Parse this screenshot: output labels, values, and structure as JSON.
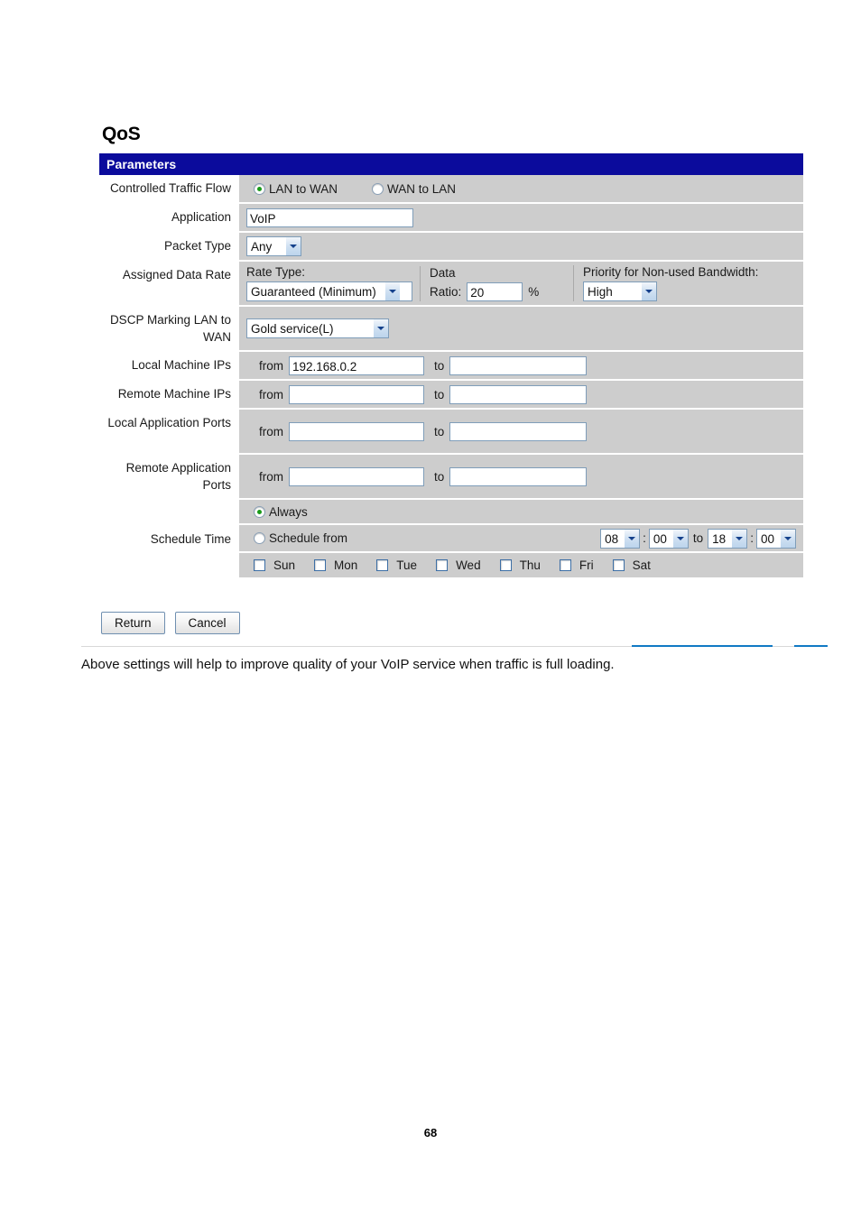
{
  "page": {
    "title": "QoS",
    "number": "68",
    "caption": "Above settings will help to improve quality of your VoIP service when traffic is full loading.",
    "accent_color": "#0b0b9c",
    "rule_color": "#1179c4"
  },
  "panel": {
    "header": "Parameters",
    "rows": {
      "controlled_traffic_flow": {
        "label": "Controlled Traffic Flow",
        "options": [
          {
            "label": "LAN to WAN",
            "selected": true
          },
          {
            "label": "WAN to LAN",
            "selected": false
          }
        ]
      },
      "application": {
        "label": "Application",
        "value": "VoIP"
      },
      "packet_type": {
        "label": "Packet Type",
        "value": "Any"
      },
      "assigned_data_rate": {
        "label": "Assigned Data Rate",
        "rate_type_label": "Rate Type:",
        "rate_type_value": "Guaranteed (Minimum)",
        "data_label": "Data",
        "ratio_label": "Ratio:",
        "ratio_value": "20",
        "percent_sign": "%",
        "priority_label": "Priority for Non-used Bandwidth:",
        "priority_value": "High"
      },
      "dscp_marking": {
        "label": "DSCP Marking LAN to WAN",
        "value": "Gold service(L)"
      },
      "local_machine_ips": {
        "label": "Local Machine IPs",
        "from_label": "from",
        "from_value": "192.168.0.2",
        "to_label": "to",
        "to_value": ""
      },
      "remote_machine_ips": {
        "label": "Remote Machine IPs",
        "from_label": "from",
        "from_value": "",
        "to_label": "to",
        "to_value": ""
      },
      "local_application_ports": {
        "label": "Local Application Ports",
        "from_label": "from",
        "from_value": "",
        "to_label": "to",
        "to_value": ""
      },
      "remote_application_ports": {
        "label": "Remote Application Ports",
        "from_label": "from",
        "from_value": "",
        "to_label": "to",
        "to_value": ""
      },
      "schedule_time": {
        "label": "Schedule Time",
        "always_label": "Always",
        "always_selected": true,
        "schedule_from_label": "Schedule from",
        "schedule_from_selected": false,
        "start_hour": "08",
        "start_minute": "00",
        "to_label": "to",
        "end_hour": "18",
        "end_minute": "00",
        "colon": ":",
        "days": [
          {
            "label": "Sun",
            "checked": false
          },
          {
            "label": "Mon",
            "checked": false
          },
          {
            "label": "Tue",
            "checked": false
          },
          {
            "label": "Wed",
            "checked": false
          },
          {
            "label": "Thu",
            "checked": false
          },
          {
            "label": "Fri",
            "checked": false
          },
          {
            "label": "Sat",
            "checked": false
          }
        ]
      }
    }
  },
  "actions": {
    "return_label": "Return",
    "cancel_label": "Cancel"
  }
}
